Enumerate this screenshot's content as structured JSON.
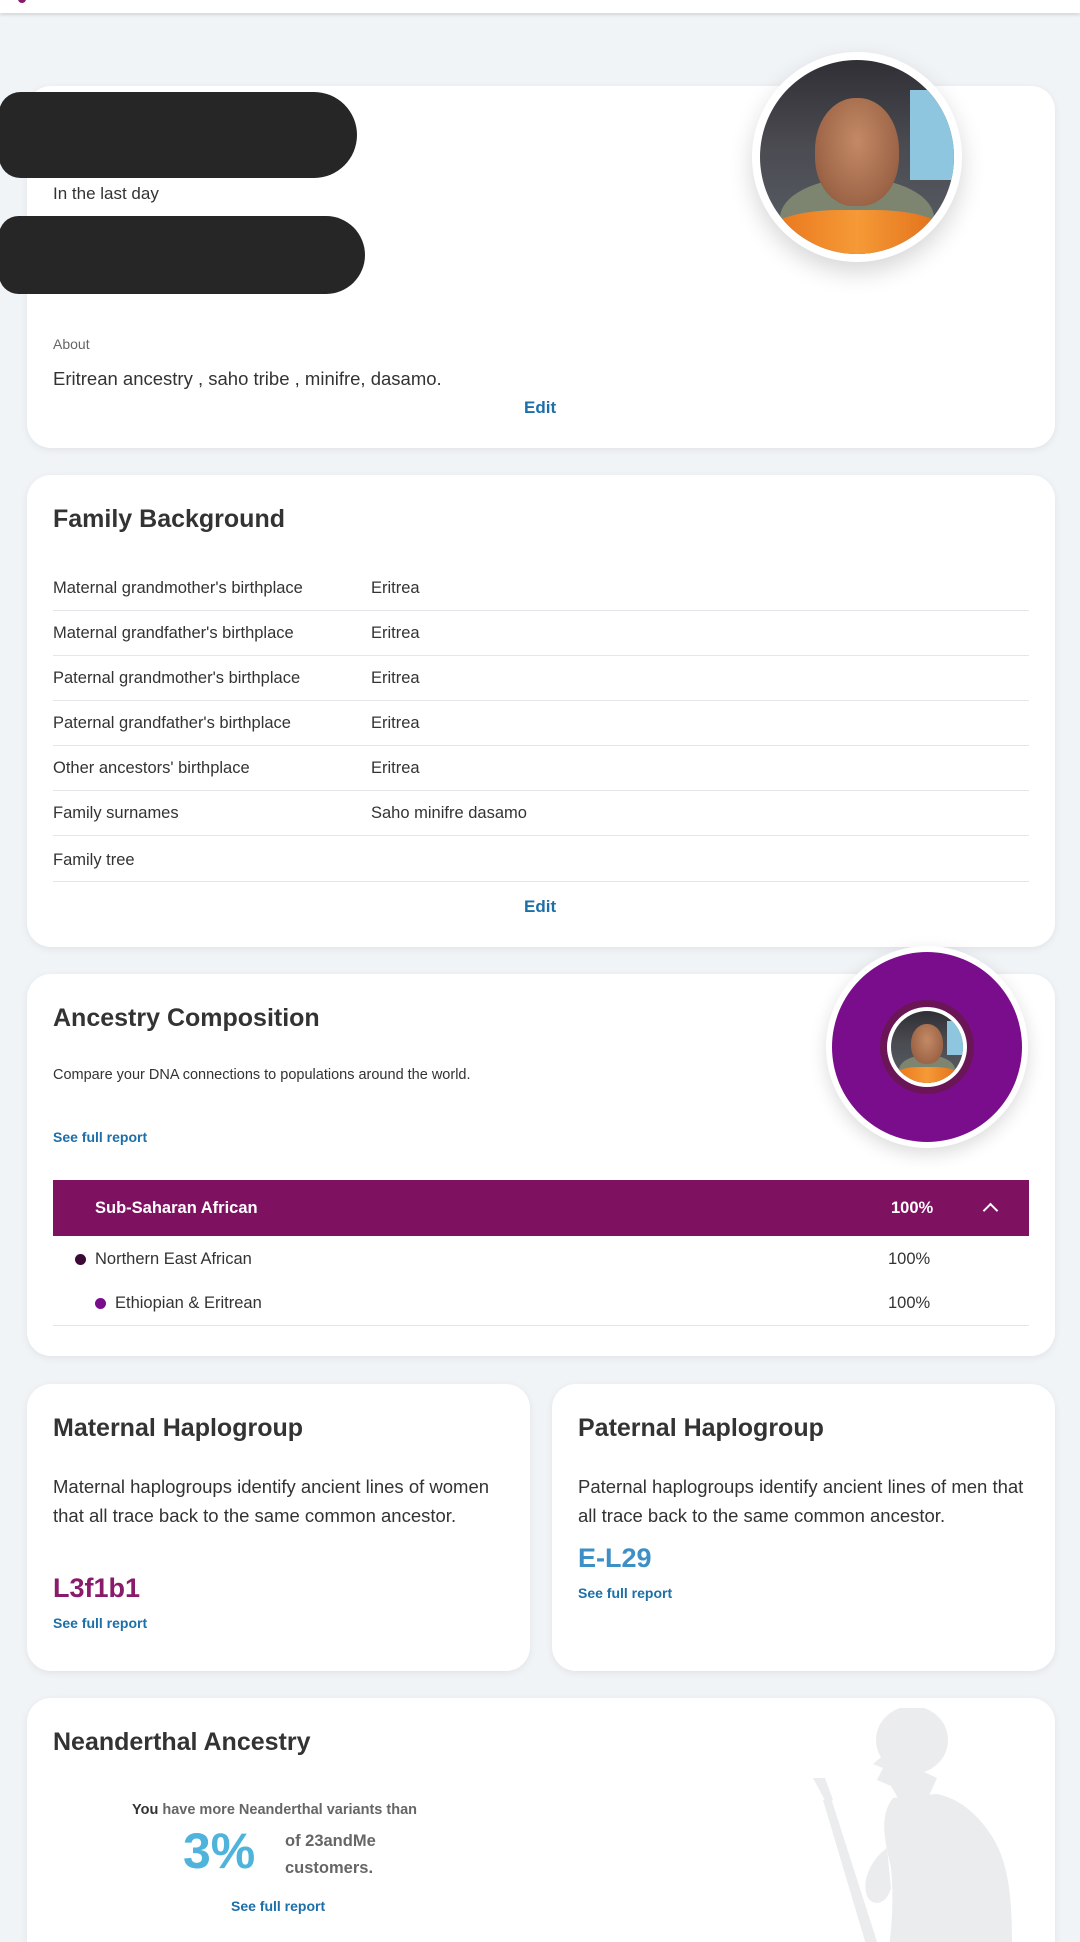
{
  "profile": {
    "last_active": "In the last day",
    "about_label": "About",
    "about_text": "Eritrean ancestry , saho tribe , minifre, dasamo.",
    "edit_label": "Edit"
  },
  "family_background": {
    "title": "Family Background",
    "rows": [
      {
        "label": "Maternal grandmother's birthplace",
        "value": "Eritrea"
      },
      {
        "label": "Maternal grandfather's birthplace",
        "value": "Eritrea"
      },
      {
        "label": "Paternal grandmother's birthplace",
        "value": "Eritrea"
      },
      {
        "label": "Paternal grandfather's birthplace",
        "value": "Eritrea"
      },
      {
        "label": "Other ancestors' birthplace",
        "value": "Eritrea"
      },
      {
        "label": "Family surnames",
        "value": "Saho minifre dasamo"
      },
      {
        "label": "Family tree",
        "value": ""
      }
    ],
    "edit_label": "Edit"
  },
  "ancestry_composition": {
    "title": "Ancestry Composition",
    "description": "Compare your DNA connections to populations around the world.",
    "link_label": "See full report",
    "region": {
      "name": "Sub-Saharan African",
      "percent": "100%",
      "color": "#7f1161"
    },
    "subregions": [
      {
        "name": "Northern East African",
        "percent": "100%",
        "color": "#3b0a36"
      },
      {
        "name": "Ethiopian & Eritrean",
        "percent": "100%",
        "color": "#7a0d8c"
      }
    ],
    "donut_color": "#7a0d8c"
  },
  "maternal_haplogroup": {
    "title": "Maternal Haplogroup",
    "description": "Maternal haplogroups identify ancient lines of women that all trace back to the same common ancestor.",
    "value": "L3f1b1",
    "value_color": "#8a1a6b",
    "link_label": "See full report"
  },
  "paternal_haplogroup": {
    "title": "Paternal Haplogroup",
    "description": "Paternal haplogroups identify ancient lines of men that all trace back to the same common ancestor.",
    "value": "E-L29",
    "value_color": "#3d8fc6",
    "link_label": "See full report"
  },
  "neanderthal": {
    "title": "Neanderthal Ancestry",
    "you": "You",
    "statement": "have more Neanderthal variants than",
    "percent": "3%",
    "of_customers": "of 23andMe customers.",
    "link_label": "See full report",
    "percent_color": "#4fb3dc"
  },
  "colors": {
    "link": "#1c6fa8",
    "background": "#f1f4f7"
  }
}
